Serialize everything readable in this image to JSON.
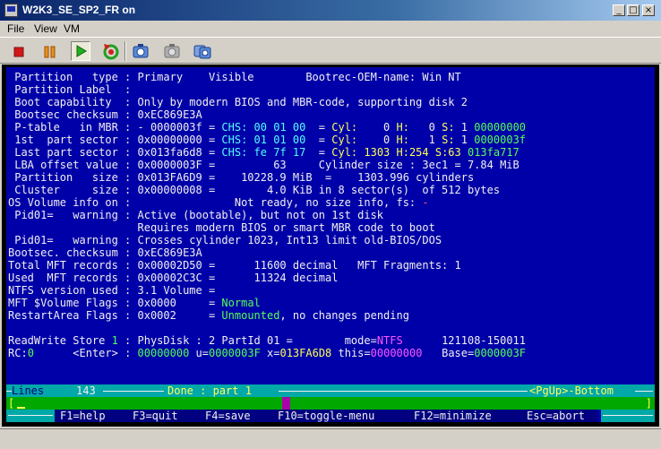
{
  "window": {
    "title": "W2K3_SE_SP2_FR on",
    "minimize": "_",
    "maximize": "□",
    "close": "×"
  },
  "menu": {
    "items": [
      "File",
      "View",
      "VM"
    ]
  },
  "toolbar": {
    "icons": [
      "stop-icon",
      "pause-icon",
      "play-icon",
      "reset-icon",
      "snapshot-icon",
      "revert-snapshot-icon",
      "snapshot-manager-icon"
    ]
  },
  "colors": {
    "console_bg": "#0000a8",
    "cyan": "#55ffff",
    "yellow": "#ffff55",
    "green": "#55ff55",
    "magenta": "#ff55ff",
    "red": "#ff5555",
    "statusbar": "#00a8a8",
    "inputbar": "#00a800"
  },
  "console": {
    "lines": [
      [
        {
          "t": " Partition   type : Primary    Visible        Bootrec-OEM-name: Win NT"
        }
      ],
      [
        {
          "t": " Partition Label  :"
        }
      ],
      [
        {
          "t": " Boot capability  : Only by modern BIOS and MBR-code, supporting disk 2"
        }
      ],
      [
        {
          "t": " Bootsec checksum : 0xEC869E3A"
        }
      ],
      [
        {
          "t": " P-table   in MBR : - 0000003f = "
        },
        {
          "t": "CHS: 00 01 00",
          "c": "c"
        },
        {
          "t": "  = "
        },
        {
          "t": "Cyl:",
          "c": "y"
        },
        {
          "t": "    0 "
        },
        {
          "t": "H:",
          "c": "y"
        },
        {
          "t": "   0 "
        },
        {
          "t": "S:",
          "c": "y"
        },
        {
          "t": " 1 "
        },
        {
          "t": "00000000",
          "c": "g"
        }
      ],
      [
        {
          "t": " 1st  part sector : 0x00000000 = "
        },
        {
          "t": "CHS: 01 01 00",
          "c": "c"
        },
        {
          "t": "  = "
        },
        {
          "t": "Cyl:",
          "c": "y"
        },
        {
          "t": "    0 "
        },
        {
          "t": "H:",
          "c": "y"
        },
        {
          "t": "   1 "
        },
        {
          "t": "S:",
          "c": "y"
        },
        {
          "t": " 1 "
        },
        {
          "t": "0000003f",
          "c": "g"
        }
      ],
      [
        {
          "t": " Last part sector : 0x013fa6d8 = "
        },
        {
          "t": "CHS: fe 7f 17",
          "c": "c"
        },
        {
          "t": "  = "
        },
        {
          "t": "Cyl: 1303 H:254 S:63",
          "c": "y"
        },
        {
          "t": " "
        },
        {
          "t": "013fa717",
          "c": "g"
        }
      ],
      [
        {
          "t": " LBA offset value : 0x0000003F =         63     Cylinder size : 3ec1 = 7.84 MiB"
        }
      ],
      [
        {
          "t": " Partition   size : 0x013FA6D9 =    10228.9 MiB  =    1303.996 cylinders"
        }
      ],
      [
        {
          "t": " Cluster     size : 0x00000008 =        4.0 KiB in 8 sector(s)  of 512 bytes"
        }
      ],
      [
        {
          "t": "OS Volume info on :                Not ready, no size info, fs: "
        },
        {
          "t": "-",
          "c": "r"
        }
      ],
      [
        {
          "t": " Pid01=   warning : Active (bootable), but not on 1st disk"
        }
      ],
      [
        {
          "t": "                    Requires modern BIOS or smart MBR code to boot"
        }
      ],
      [
        {
          "t": " Pid01=   warning : Crosses cylinder 1023, Int13 limit old-BIOS/DOS"
        }
      ],
      [
        {
          "t": "Bootsec. checksum : 0xEC869E3A"
        }
      ],
      [
        {
          "t": "Total MFT records : 0x00002D50 =      11600 decimal   MFT Fragments: 1"
        }
      ],
      [
        {
          "t": "Used  MFT records : 0x00002C3C =      11324 decimal"
        }
      ],
      [
        {
          "t": "NTFS version used : 3.1 Volume ="
        }
      ],
      [
        {
          "t": "MFT $Volume Flags : 0x0000     = "
        },
        {
          "t": "Normal",
          "c": "g"
        }
      ],
      [
        {
          "t": "RestartArea Flags : 0x0002     = "
        },
        {
          "t": "Unmounted",
          "c": "g"
        },
        {
          "t": ", no changes pending"
        }
      ],
      [
        {
          "t": ""
        }
      ],
      [
        {
          "t": "ReadWrite Store "
        },
        {
          "t": "1",
          "c": "g"
        },
        {
          "t": " : PhysDisk : 2 PartId 01 =        mode="
        },
        {
          "t": "NTFS",
          "c": "m"
        },
        {
          "t": "      121108-150011"
        }
      ],
      [
        {
          "t": "RC:"
        },
        {
          "t": "0",
          "c": "g"
        },
        {
          "t": "      <Enter> : "
        },
        {
          "t": "00000000",
          "c": "g"
        },
        {
          "t": " u="
        },
        {
          "t": "0000003F",
          "c": "g"
        },
        {
          "t": " x="
        },
        {
          "t": "013FA6D8",
          "c": "y"
        },
        {
          "t": " this="
        },
        {
          "t": "00000000",
          "c": "m"
        },
        {
          "t": "   Base="
        },
        {
          "t": "0000003F",
          "c": "g"
        }
      ]
    ]
  },
  "status": {
    "lines_label": "Lines",
    "lines_count": "143",
    "done": "Done : part 1",
    "nav": "<PgUp>-Bottom"
  },
  "input": {
    "left_bracket": "[",
    "right_bracket": "]"
  },
  "fkeys": [
    {
      "label": "F1=help"
    },
    {
      "label": "F3=quit"
    },
    {
      "label": "F4=save"
    },
    {
      "label": "F10=toggle-menu"
    },
    {
      "label": "F12=minimize"
    },
    {
      "label": "Esc=abort"
    }
  ]
}
